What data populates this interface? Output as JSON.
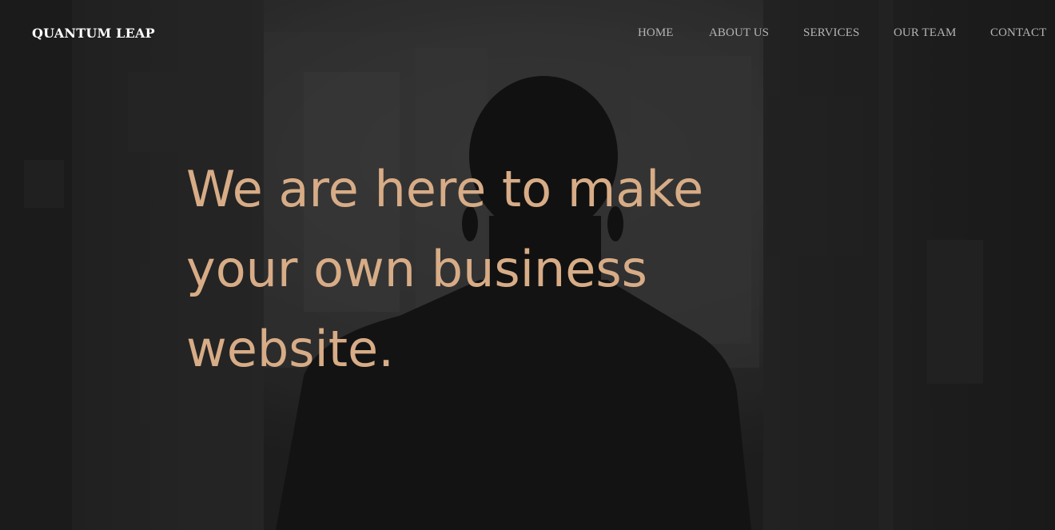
{
  "brand": {
    "name": "QUANTUM LEAP"
  },
  "nav": {
    "items": [
      {
        "label": "HOME"
      },
      {
        "label": "ABOUT US"
      },
      {
        "label": "SERVICES"
      },
      {
        "label": "OUR TEAM"
      },
      {
        "label": "CONTACT"
      }
    ]
  },
  "hero": {
    "headline_lines": [
      "We are here to make",
      "your own business",
      "website."
    ],
    "background_image": "silhouette-of-man-in-suit-photo"
  },
  "colors": {
    "accent": "#d7ac86",
    "brand_text": "#ffffff",
    "nav_text": "#b4b4b4",
    "background": "#232323"
  }
}
